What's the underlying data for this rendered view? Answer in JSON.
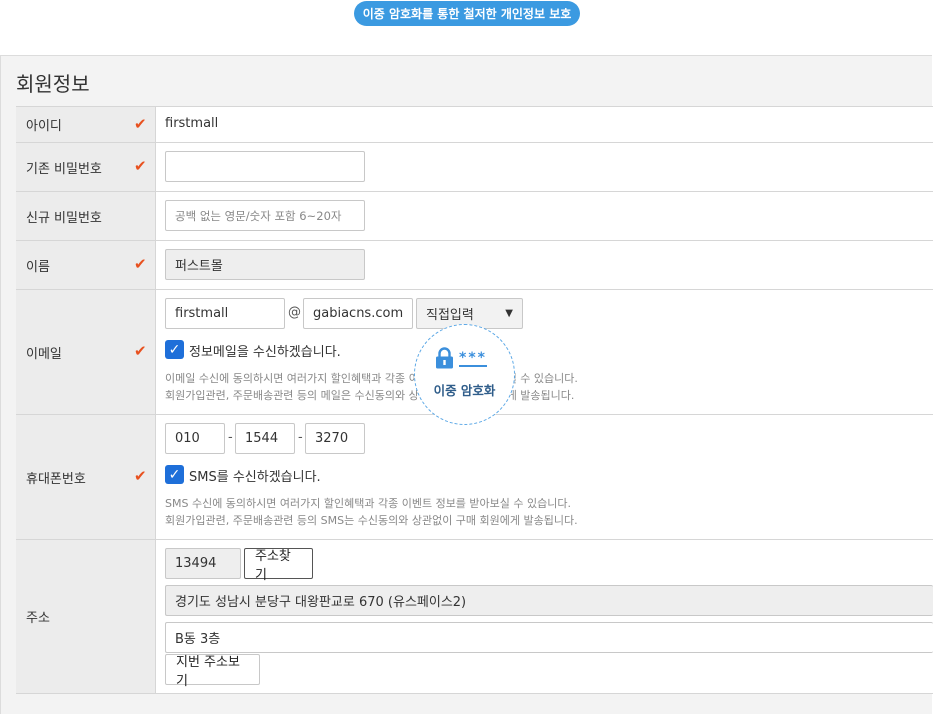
{
  "banner": "이중 암호화를 통한 철저한 개인정보 보호",
  "section_title": "회원정보",
  "check_mark": "✔",
  "fields": {
    "id": {
      "label": "아이디",
      "value": "firstmall"
    },
    "current_password": {
      "label": "기존 비밀번호",
      "value": ""
    },
    "new_password": {
      "label": "신규 비밀번호",
      "placeholder": "공백 없는 영문/숫자 포함 6~20자"
    },
    "name": {
      "label": "이름",
      "value": "퍼스트몰"
    },
    "email": {
      "label": "이메일",
      "local": "firstmall",
      "at": "@",
      "domain": "gabiacns.com",
      "select": "직접입력",
      "checkbox_label": "정보메일을 수신하겠습니다.",
      "note1": "이메일 수신에 동의하시면 여러가지 할인혜택과 각종 이벤트 정보를 받아보실 수 있습니다.",
      "note2": "회원가입관련, 주문배송관련 등의 메일은 수신동의와 상관없이 구매 회원에게 발송됩니다."
    },
    "phone": {
      "label": "휴대폰번호",
      "p1": "010",
      "p2": "1544",
      "p3": "3270",
      "dash": "-",
      "checkbox_label": "SMS를 수신하겠습니다.",
      "note1": "SMS 수신에 동의하시면 여러가지 할인혜택과 각종 이벤트 정보를 받아보실 수 있습니다.",
      "note2": "회원가입관련, 주문배송관련 등의 SMS는 수신동의와 상관없이 구매 회원에게 발송됩니다."
    },
    "address": {
      "label": "주소",
      "zipcode": "13494",
      "search_button": "주소찾기",
      "address1": "경기도 성남시 분당구 대왕판교로 670 (유스페이스2)",
      "address2": "B동 3층",
      "jibun_button": "지번 주소보기"
    }
  },
  "badge": {
    "stars": "***",
    "text": "이중 암호화"
  },
  "colors": {
    "accent": "#3b9ae1",
    "check": "#e8511f",
    "checkbox": "#1e6fd9"
  }
}
